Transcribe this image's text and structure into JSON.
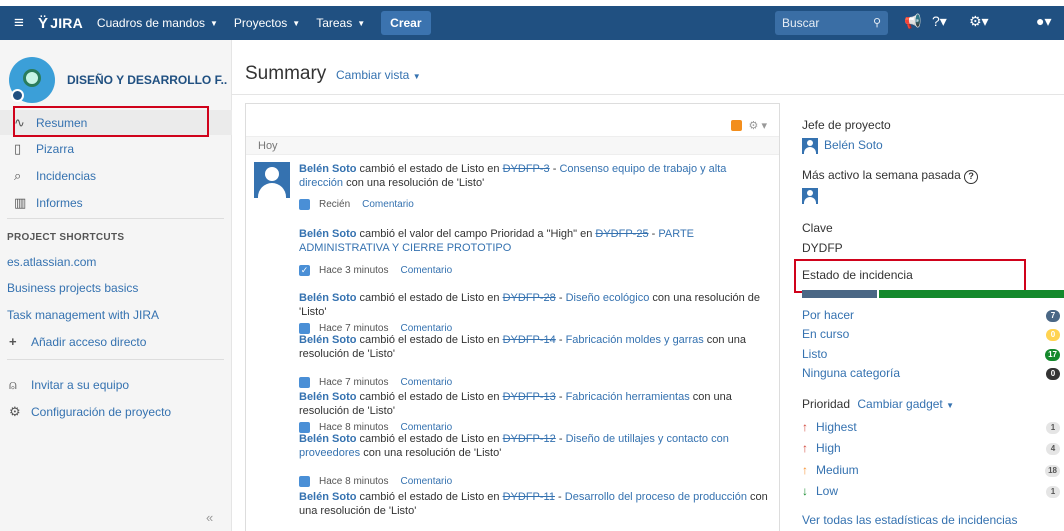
{
  "topbar": {
    "logo": "JIRA",
    "menus": [
      "Cuadros de mandos",
      "Proyectos",
      "Tareas"
    ],
    "create_label": "Crear",
    "search_placeholder": "Buscar"
  },
  "sidebar": {
    "project_name": "DISEÑO Y DESARROLLO F..",
    "items": [
      {
        "label": "Resumen",
        "icon": "pulse-icon"
      },
      {
        "label": "Pizarra",
        "icon": "board-icon"
      },
      {
        "label": "Incidencias",
        "icon": "issues-icon"
      },
      {
        "label": "Informes",
        "icon": "reports-icon"
      }
    ],
    "shortcuts_title": "PROJECT SHORTCUTS",
    "shortcuts": [
      "es.atlassian.com",
      "Business projects basics",
      "Task management with JIRA"
    ],
    "add_shortcut": "Añadir acceso directo",
    "invite": "Invitar a su equipo",
    "config": "Configuración de proyecto"
  },
  "main": {
    "title": "Summary",
    "change_view": "Cambiar vista"
  },
  "activity": {
    "day": "Hoy",
    "comment_label": "Comentario",
    "entries": [
      {
        "user": "Belén Soto",
        "pre": " cambió el estado de Listo en ",
        "issue": "DYDFP-3",
        "summary": "Consenso equipo de trabajo y alta dirección",
        "post": " con una resolución de 'Listo'",
        "time": "Recién",
        "type": "task"
      },
      {
        "user": "Belén Soto",
        "pre": " cambió el valor del campo Prioridad a \"High\" en ",
        "issue": "DYDFP-25",
        "summary": "PARTE ADMINISTRATIVA Y CIERRE PROTOTIPO",
        "post": "",
        "time": "Hace 3 minutos",
        "type": "check"
      },
      {
        "user": "Belén Soto",
        "pre": " cambió el estado de Listo en ",
        "issue": "DYDFP-28",
        "summary": "Diseño ecológico",
        "post": " con una resolución de 'Listo'",
        "time": "Hace 7 minutos",
        "type": "task"
      },
      {
        "user": "Belén Soto",
        "pre": " cambió el estado de Listo en ",
        "issue": "DYDFP-14",
        "summary": "Fabricación moldes y garras",
        "post": " con una resolución de 'Listo'",
        "time": "Hace 7 minutos",
        "type": "task"
      },
      {
        "user": "Belén Soto",
        "pre": " cambió el estado de Listo en ",
        "issue": "DYDFP-13",
        "summary": "Fabricación herramientas",
        "post": " con una resolución de 'Listo'",
        "time": "Hace 8 minutos",
        "type": "task"
      },
      {
        "user": "Belén Soto",
        "pre": " cambió el estado de Listo en ",
        "issue": "DYDFP-12",
        "summary": "Diseño de utillajes y contacto con proveedores",
        "post": " con una resolución de 'Listo'",
        "time": "Hace 8 minutos",
        "type": "task"
      },
      {
        "user": "Belén Soto",
        "pre": " cambió el estado de Listo en ",
        "issue": "DYDFP-11",
        "summary": "Desarrollo del proceso de producción",
        "post": " con una resolución de 'Listo'",
        "time": "",
        "type": "task"
      }
    ]
  },
  "details": {
    "lead_label": "Jefe de proyecto",
    "lead_name": "Belén Soto",
    "active_label": "Más activo la semana pasada",
    "key_label": "Clave",
    "key_value": "DYDFP",
    "status_label": "Estado de incidencia",
    "status_bar": {
      "todo_fraction": 0.29,
      "done_fraction": 0.71,
      "todo_color": "#4a6785",
      "done_color": "#14892c"
    },
    "statuses": [
      {
        "label": "Por hacer",
        "count": "7",
        "color": "#4a6785"
      },
      {
        "label": "En curso",
        "count": "0",
        "color": "#ffd351"
      },
      {
        "label": "Listo",
        "count": "17",
        "color": "#14892c"
      },
      {
        "label": "Ninguna categoría",
        "count": "0",
        "color": "#333333"
      }
    ],
    "priority_label": "Prioridad",
    "change_gadget": "Cambiar gadget",
    "priorities": [
      {
        "label": "Highest",
        "count": "1",
        "color": "#d04437"
      },
      {
        "label": "High",
        "count": "4",
        "color": "#d04437"
      },
      {
        "label": "Medium",
        "count": "18",
        "color": "#f79232"
      },
      {
        "label": "Low",
        "count": "1",
        "color": "#14892c"
      }
    ],
    "all_stats": "Ver todas las estadísticas de incidencias"
  }
}
